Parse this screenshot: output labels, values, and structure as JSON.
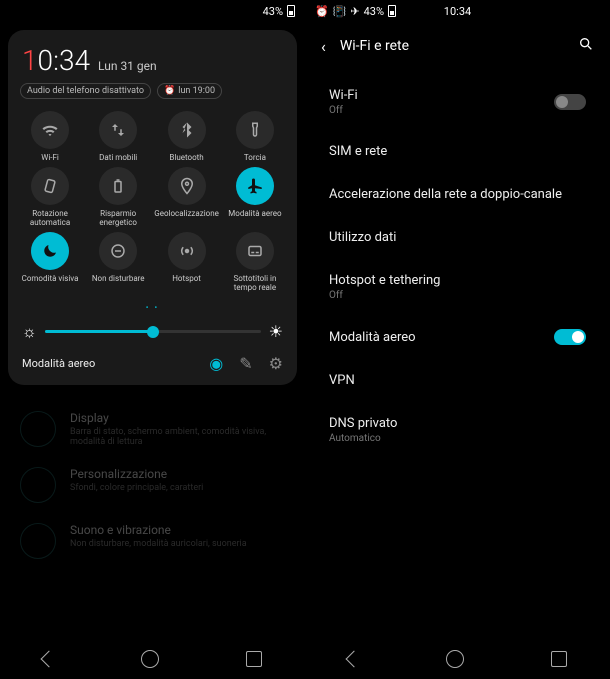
{
  "status": {
    "battery": "43%",
    "time": "10:34"
  },
  "qs": {
    "time_h": "0",
    "time_rest": ":34",
    "date": "Lun 31 gen",
    "chip_audio": "Audio del telefono disattivato",
    "chip_alarm": "lun 19:00",
    "tiles": [
      {
        "label": "Wi-Fi",
        "icon": "wifi",
        "on": false
      },
      {
        "label": "Dati mobili",
        "icon": "data",
        "on": false
      },
      {
        "label": "Bluetooth",
        "icon": "bluetooth",
        "on": false
      },
      {
        "label": "Torcia",
        "icon": "torch",
        "on": false
      },
      {
        "label": "Rotazione automatica",
        "icon": "rotate",
        "on": false
      },
      {
        "label": "Risparmio energetico",
        "icon": "battery",
        "on": false
      },
      {
        "label": "Geolocalizzazione",
        "icon": "location",
        "on": false
      },
      {
        "label": "Modalità aereo",
        "icon": "airplane",
        "on": true
      },
      {
        "label": "Comodità visiva",
        "icon": "moon",
        "on": true
      },
      {
        "label": "Non disturbare",
        "icon": "dnd",
        "on": false
      },
      {
        "label": "Hotspot",
        "icon": "hotspot",
        "on": false
      },
      {
        "label": "Sottotitoli in tempo reale",
        "icon": "caption",
        "on": false
      }
    ],
    "footer_label": "Modalità aereo"
  },
  "dim": {
    "items": [
      {
        "title": "Display",
        "sub": "Barra di stato, schermo ambient, comodità visiva, modalità di lettura"
      },
      {
        "title": "Personalizzazione",
        "sub": "Sfondi, colore principale, caratteri"
      },
      {
        "title": "Suono e vibrazione",
        "sub": "Non disturbare, modalità auricolari, suoneria"
      }
    ]
  },
  "settings": {
    "header": "Wi-Fi e rete",
    "items": [
      {
        "title": "Wi-Fi",
        "sub": "Off",
        "toggle": false
      },
      {
        "title": "SIM e rete",
        "sub": ""
      },
      {
        "title": "Accelerazione della rete a doppio-canale",
        "sub": ""
      },
      {
        "title": "Utilizzo dati",
        "sub": ""
      },
      {
        "title": "Hotspot e tethering",
        "sub": "Off"
      },
      {
        "title": "Modalità aereo",
        "sub": "",
        "toggle": true
      },
      {
        "title": "VPN",
        "sub": ""
      },
      {
        "title": "DNS privato",
        "sub": "Automatico"
      }
    ]
  }
}
